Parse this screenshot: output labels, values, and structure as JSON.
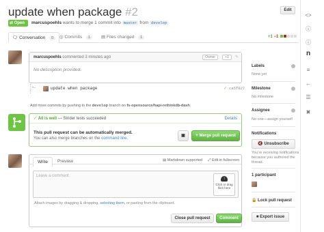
{
  "header": {
    "title": "update when package",
    "number": "#2",
    "edit_label": "Edit",
    "status": "Open",
    "author": "marcuspoehls",
    "meta_text": "wants to merge 1 commit into",
    "base_branch": "master",
    "from_text": "from",
    "head_branch": "develop"
  },
  "tabs": [
    {
      "label": "Conversation",
      "count": "0"
    },
    {
      "label": "Commits",
      "count": "1"
    },
    {
      "label": "Files changed",
      "count": "1"
    }
  ],
  "diffstat": {
    "additions": "+1",
    "deletions": "−1"
  },
  "comment": {
    "author": "marcuspoehls",
    "time": "commented 3 minutes ago",
    "owner_label": "Owner",
    "reaction_label": "+1",
    "body": "No description provided."
  },
  "commit": {
    "message": "update when package",
    "sha": "ca5f827"
  },
  "merge_info": {
    "prefix": "Add more commits by pushing to the",
    "branch": "develop",
    "middle": "branch on",
    "repo": "fs-opensource/hapi-rethinkdb-dash",
    "suffix": "."
  },
  "merge_box": {
    "status_strong": "All is well",
    "status_rest": "— Strider tests succeeded",
    "details_label": "Details",
    "heading": "This pull request can be automatically merged.",
    "sub_text": "You can also merge branches on the",
    "cmd_link": "command line",
    "sub_suffix": ".",
    "merge_button": "Merge pull request"
  },
  "new_comment": {
    "write_tab": "Write",
    "preview_tab": "Preview",
    "markdown_label": "Markdown supported",
    "fullscreen_label": "Edit in fullscreen",
    "placeholder": "Leave a comment",
    "drop_text_1": "Click or drag",
    "drop_text_2": "files here",
    "attach_prefix": "Attach images by dragging & dropping,",
    "attach_link": "selecting them",
    "attach_suffix": ", or pasting from the clipboard.",
    "close_button": "Close pull request",
    "comment_button": "Comment"
  },
  "sidebar": {
    "labels_title": "Labels",
    "labels_value": "None yet",
    "milestone_title": "Milestone",
    "milestone_value": "No milestone",
    "assignee_title": "Assignee",
    "assignee_value": "No one—assign yourself",
    "notifications_title": "Notifications",
    "unsubscribe_label": "Unsubscribe",
    "notif_text": "You’re receiving notifications because you authored the thread.",
    "participants_title": "1 participant",
    "lock_label": "Lock pull request",
    "export_label": "Export issue"
  },
  "colors": {
    "open_green": "#6cc644",
    "merge_green": "#6cc644",
    "link_blue": "#4183c4"
  }
}
